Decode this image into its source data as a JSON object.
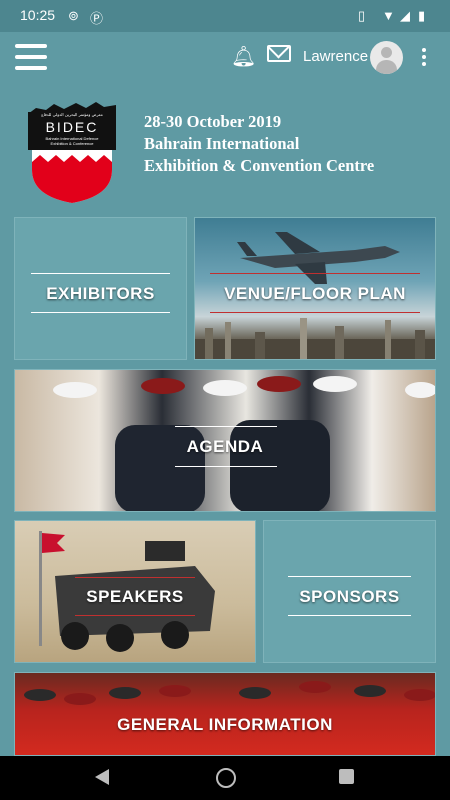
{
  "status_bar": {
    "time": "10:25"
  },
  "app_bar": {
    "username": "Lawrence"
  },
  "logo": {
    "brand": "BIDEC",
    "line1": "Bahrain International Defence",
    "line2": "Exhibition & Conference",
    "arabic": "معرض ومؤتمر البحرين الدولي للدفاع"
  },
  "event": {
    "dates": "28-30 October 2019",
    "venue_line1": "Bahrain International",
    "venue_line2": "Exhibition & Convention Centre"
  },
  "tiles": {
    "exhibitors": "EXHIBITORS",
    "venue": "VENUE/FLOOR PLAN",
    "agenda": "AGENDA",
    "speakers": "SPEAKERS",
    "sponsors": "SPONSORS",
    "general": "GENERAL INFORMATION"
  },
  "colors": {
    "background": "#5f9aa3",
    "tile": "#6aa5ad",
    "nav": "#000000"
  }
}
